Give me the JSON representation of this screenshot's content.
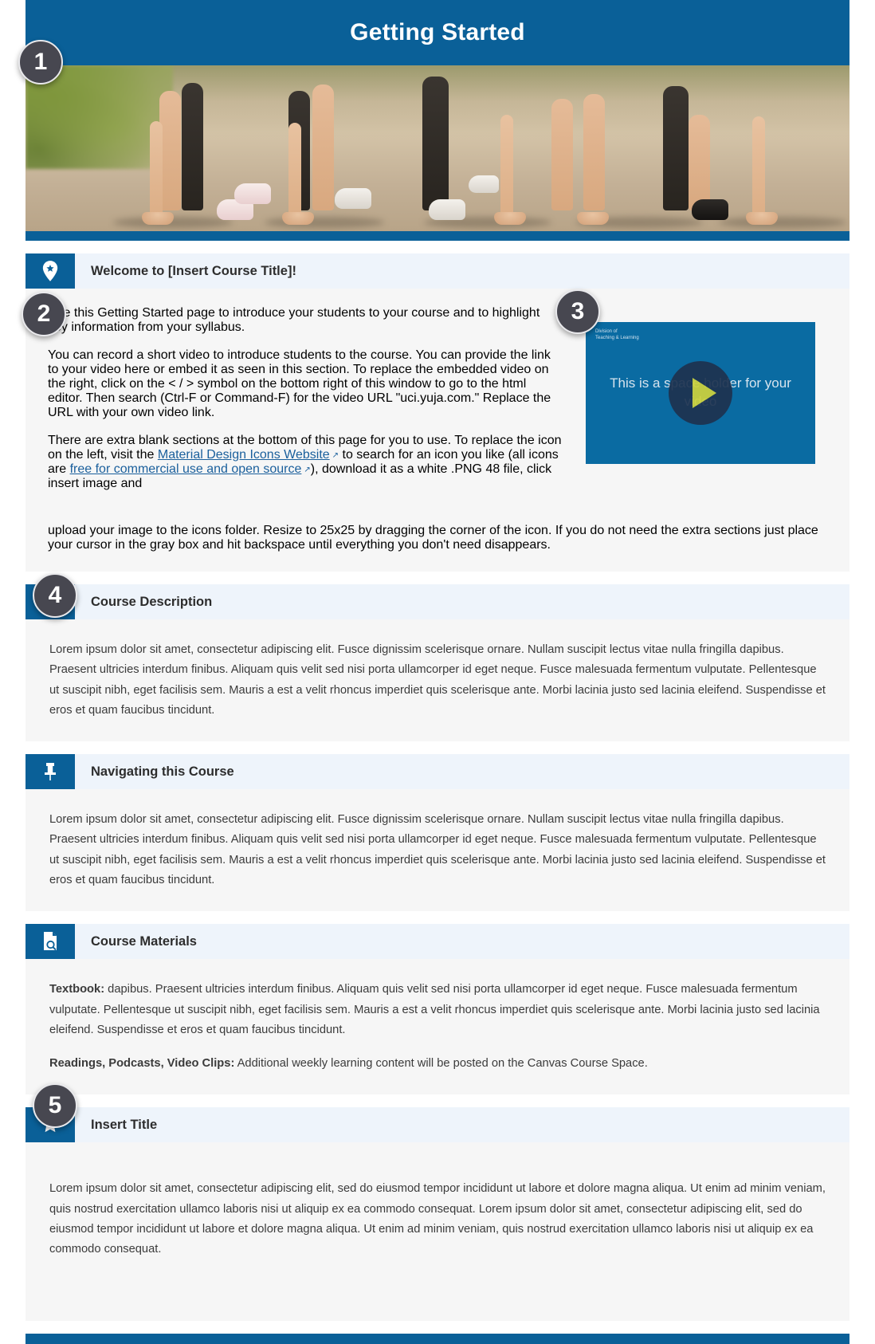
{
  "banner": {
    "title": "Getting Started",
    "image_alt": "runners crouched at starting line on gravel path",
    "accent_color": "#0a6098"
  },
  "callouts": [
    {
      "number": "1",
      "target": "banner"
    },
    {
      "number": "2",
      "target": "welcome-body-text"
    },
    {
      "number": "3",
      "target": "video-placeholder"
    },
    {
      "number": "4",
      "target": "course-description-header"
    },
    {
      "number": "5",
      "target": "insert-title-body"
    }
  ],
  "sections": [
    {
      "id": "welcome",
      "icon": "map-pin-icon",
      "title": "Welcome to [Insert Course Title]!",
      "paragraphs": [
        "Use this Getting Started page to introduce your students to your course and to highlight key information from your syllabus.",
        "You can record a short video to introduce students to the course. You can provide the link to your video here or embed it as seen in this section. To replace the embedded video on the right, click on the < / > symbol on the bottom right of this window to go to the html editor. Then search (Ctrl-F or Command-F) for the video URL \"uci.yuja.com.\" Replace the URL with your own video link."
      ],
      "link_paragraph": {
        "before": "There are extra blank sections at the bottom of this page for you to use. To replace the icon on the left, visit the ",
        "link1": "Material Design Icons Website",
        "middle": " to search for an icon you like (all icons are ",
        "link2": "free for commercial use and open source",
        "after": "), download it as a white .PNG 48 file, click insert image and"
      },
      "tail_paragraph": "upload your image to the icons folder. Resize to 25x25 by dragging the corner of the icon. If you do not need the extra sections just place your cursor in the gray box and hit backspace until everything you don't need disappears."
    },
    {
      "id": "course-description",
      "icon": "target-icon",
      "title": "Course Description",
      "paragraphs": [
        "Lorem ipsum dolor sit amet, consectetur adipiscing elit. Fusce dignissim scelerisque ornare. Nullam suscipit lectus vitae nulla fringilla dapibus. Praesent ultricies interdum finibus. Aliquam quis velit sed nisi porta ullamcorper id eget neque. Fusce malesuada fermentum vulputate. Pellentesque ut suscipit nibh, eget facilisis sem. Mauris a est a velit rhoncus imperdiet quis scelerisque ante. Morbi lacinia justo sed lacinia eleifend. Suspendisse et eros et quam faucibus tincidunt."
      ]
    },
    {
      "id": "navigating-this-course",
      "icon": "pushpin-icon",
      "title": "Navigating this Course",
      "paragraphs": [
        "Lorem ipsum dolor sit amet, consectetur adipiscing elit. Fusce dignissim scelerisque ornare. Nullam suscipit lectus vitae nulla fringilla dapibus. Praesent ultricies interdum finibus. Aliquam quis velit sed nisi porta ullamcorper id eget neque. Fusce malesuada fermentum vulputate. Pellentesque ut suscipit nibh, eget facilisis sem. Mauris a est a velit rhoncus imperdiet quis scelerisque ante. Morbi lacinia justo sed lacinia eleifend. Suspendisse et eros et quam faucibus tincidunt."
      ]
    },
    {
      "id": "course-materials",
      "icon": "document-search-icon",
      "title": "Course Materials",
      "textbook_label": "Textbook:",
      "textbook_text": " dapibus. Praesent ultricies interdum finibus. Aliquam quis velit sed nisi porta ullamcorper id eget neque. Fusce malesuada fermentum vulputate. Pellentesque ut suscipit nibh, eget facilisis sem. Mauris a est a velit rhoncus imperdiet quis scelerisque ante. Morbi lacinia justo sed lacinia eleifend. Suspendisse et eros et quam faucibus tincidunt.",
      "readings_label": "Readings, Podcasts, Video Clips:",
      "readings_text": " Additional weekly learning content will be posted on the Canvas Course Space."
    },
    {
      "id": "insert-title",
      "icon": "star-icon",
      "title": "Insert Title",
      "paragraphs": [
        "Lorem ipsum dolor sit amet, consectetur adipiscing elit, sed do eiusmod tempor incididunt ut labore et dolore magna aliqua. Ut enim ad minim veniam, quis nostrud exercitation ullamco laboris nisi ut aliquip ex ea commodo consequat. Lorem ipsum dolor sit amet, consectetur adipiscing elit, sed do eiusmod tempor incididunt ut labore et dolore magna aliqua. Ut enim ad minim veniam, quis nostrud exercitation ullamco laboris nisi ut aliquip ex ea commodo consequat."
      ]
    }
  ],
  "video": {
    "caption": "This is a space holder for your video",
    "logo_line1": "Division of",
    "logo_line2": "Teaching & Learning",
    "play_label": "play-button"
  },
  "external_link_glyph": "↗"
}
